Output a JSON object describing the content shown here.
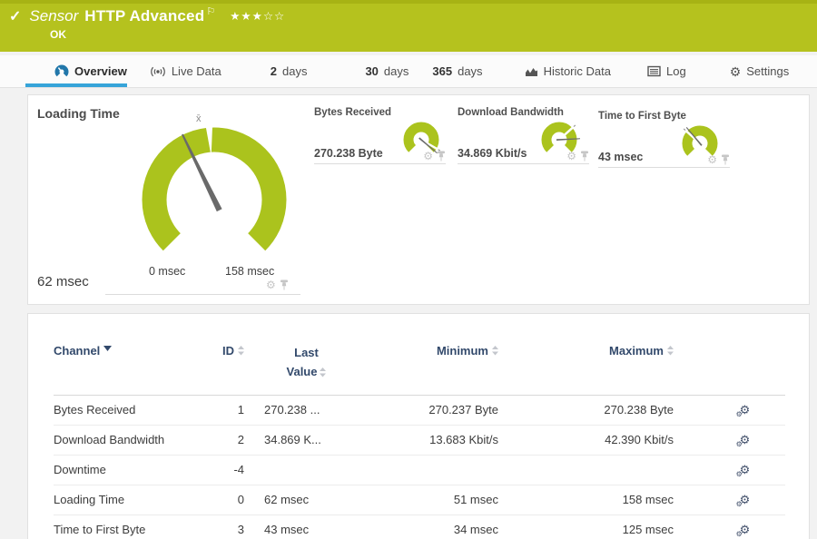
{
  "header": {
    "check_glyph": "✓",
    "type_label": "Sensor",
    "title": "HTTP Advanced",
    "flag_glyph": "⚐",
    "stars_filled": "★★★",
    "stars_empty": "☆☆",
    "status": "OK"
  },
  "tabs": [
    {
      "label": "Overview",
      "icon": "gauge-overview-icon",
      "active": true
    },
    {
      "label": "Live Data",
      "icon": "live-data-icon"
    },
    {
      "num": "2",
      "label": "days"
    },
    {
      "num": "30",
      "label": "days"
    },
    {
      "num": "365",
      "label": "days"
    },
    {
      "label": "Historic Data",
      "icon": "historic-data-icon"
    },
    {
      "label": "Log",
      "icon": "log-icon"
    },
    {
      "label": "Settings",
      "icon": "settings-gear-icon"
    }
  ],
  "icons": {
    "gear": "⚙"
  },
  "gauges": {
    "main": {
      "title": "Loading Time",
      "value": "62 msec",
      "scale_min": "0 msec",
      "scale_max": "158 msec",
      "avg_marker": "x̄"
    },
    "minis": [
      {
        "title": "Bytes Received",
        "value": "270.238 Byte"
      },
      {
        "title": "Download Bandwidth",
        "value": "34.869 Kbit/s"
      },
      {
        "title": "Time to First Byte",
        "value": "43 msec"
      }
    ]
  },
  "table": {
    "columns": {
      "channel": "Channel",
      "id": "ID",
      "last_value": "Last Value",
      "minimum": "Minimum",
      "maximum": "Maximum"
    },
    "rows": [
      {
        "channel": "Bytes Received",
        "id": "1",
        "last": "270.238 ...",
        "min": "270.237 Byte",
        "max": "270.238 Byte"
      },
      {
        "channel": "Download Bandwidth",
        "id": "2",
        "last": "34.869 K...",
        "min": "13.683 Kbit/s",
        "max": "42.390 Kbit/s"
      },
      {
        "channel": "Downtime",
        "id": "-4",
        "last": "",
        "min": "",
        "max": ""
      },
      {
        "channel": "Loading Time",
        "id": "0",
        "last": "62 msec",
        "min": "51 msec",
        "max": "158 msec"
      },
      {
        "channel": "Time to First Byte",
        "id": "3",
        "last": "43 msec",
        "min": "34 msec",
        "max": "125 msec"
      }
    ]
  },
  "colors": {
    "brand_green": "#b5c21e",
    "gauge_green": "#abc31d",
    "active_tab_blue": "#36a4d9",
    "table_header_navy": "#32496b"
  }
}
